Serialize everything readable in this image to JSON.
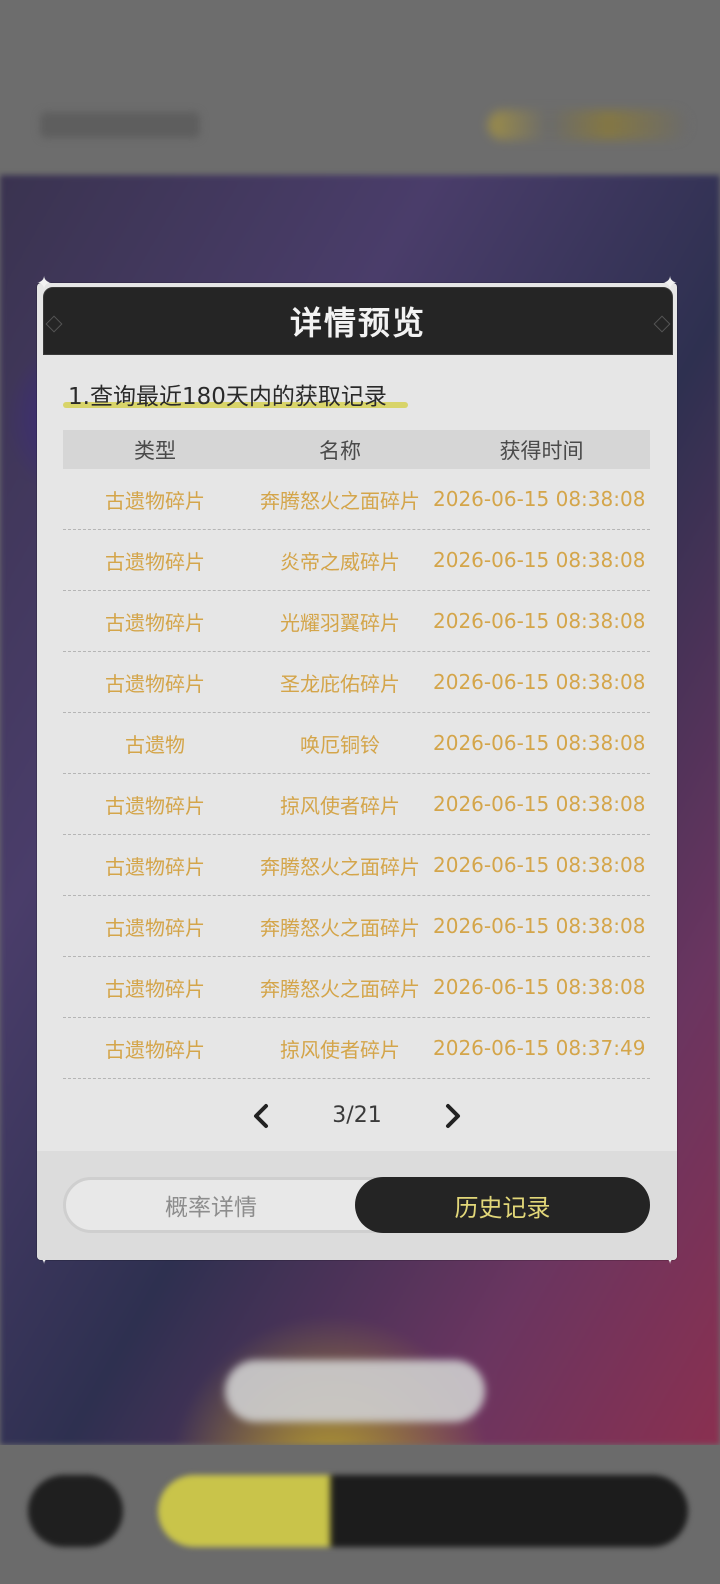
{
  "modal": {
    "title": "详情预览",
    "query_label": "1.查询最近180天内的获取记录"
  },
  "table": {
    "headers": [
      "类型",
      "名称",
      "获得时间"
    ],
    "rows": [
      [
        "古遗物碎片",
        "奔腾怒火之面碎片",
        "2026-06-15 08:38:08"
      ],
      [
        "古遗物碎片",
        "炎帝之威碎片",
        "2026-06-15 08:38:08"
      ],
      [
        "古遗物碎片",
        "光耀羽翼碎片",
        "2026-06-15 08:38:08"
      ],
      [
        "古遗物碎片",
        "圣龙庇佑碎片",
        "2026-06-15 08:38:08"
      ],
      [
        "古遗物",
        "唤厄铜铃",
        "2026-06-15 08:38:08"
      ],
      [
        "古遗物碎片",
        "掠风使者碎片",
        "2026-06-15 08:38:08"
      ],
      [
        "古遗物碎片",
        "奔腾怒火之面碎片",
        "2026-06-15 08:38:08"
      ],
      [
        "古遗物碎片",
        "奔腾怒火之面碎片",
        "2026-06-15 08:38:08"
      ],
      [
        "古遗物碎片",
        "奔腾怒火之面碎片",
        "2026-06-15 08:38:08"
      ],
      [
        "古遗物碎片",
        "掠风使者碎片",
        "2026-06-15 08:37:49"
      ]
    ]
  },
  "pager": {
    "current_page": 3,
    "total_pages": 21,
    "label": "3/21",
    "prev_icon": "chevron-left-icon",
    "next_icon": "chevron-right-icon"
  },
  "tabs": {
    "probability_label": "概率详情",
    "history_label": "历史记录",
    "active": "history"
  },
  "colors": {
    "accent_text": "#d4a54a",
    "active_tab_text": "#e2d779",
    "header_bg": "#252525",
    "underline": "#d8d469"
  }
}
